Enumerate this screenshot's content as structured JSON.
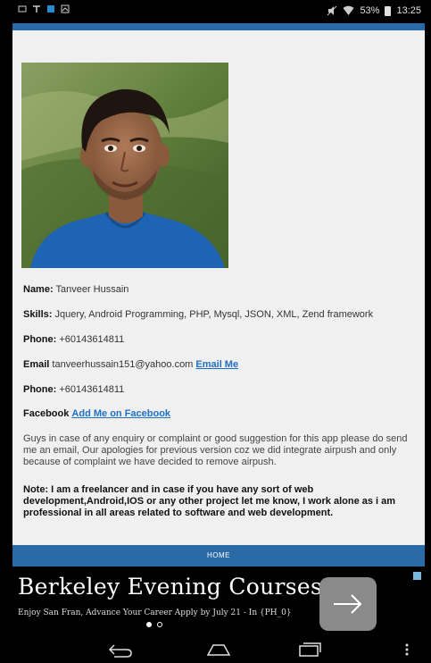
{
  "status_bar": {
    "battery": "53%",
    "time": "13:25"
  },
  "profile": {
    "name_label": "Name:",
    "name_value": " Tanveer Hussain",
    "skills_label": "Skills:",
    "skills_value": " Jquery, Android Programming, PHP, Mysql, JSON, XML, Zend framework",
    "phone_label": "Phone:",
    "phone_value": " +60143614811",
    "email_label": "Email",
    "email_value": " tanveerhussain151@yahoo.com ",
    "email_link": "Email Me",
    "phone2_label": "Phone:",
    "phone2_value": " +60143614811",
    "facebook_label": "Facebook",
    "facebook_link": "Add Me on Facebook",
    "note_text": "Guys in case of any enquiry or complaint or good suggestion for this app please do send me an email, Our apologies for previous version coz we did integrate airpush and only because of complaint we have decided to remove airpush.",
    "freelance_note": "Note: I am a freelancer and in case if you have any sort of web development,Android,IOS or any other project let me know, I work alone as i am professional in all areas related to software and web development."
  },
  "home_bar": {
    "label": "HOME"
  },
  "ad": {
    "title": "Berkeley Evening Courses",
    "subtitle": "Enjoy San Fran, Advance Your Career Apply by July 21 - In {PH_0}"
  },
  "colors": {
    "accent": "#2a6aa7",
    "link": "#1f6fc5",
    "content_bg": "#f0f0f0"
  },
  "icons": [
    "notification-icon",
    "wifi-icon",
    "battery-icon",
    "arrow-right-icon",
    "back-icon",
    "home-icon",
    "recents-icon",
    "menu-icon",
    "adchoices-icon"
  ]
}
